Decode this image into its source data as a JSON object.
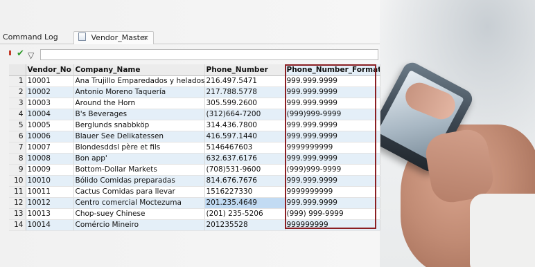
{
  "tabs": {
    "command_log": "Command Log",
    "vendor_master": "Vendor_Master",
    "close_glyph": "×"
  },
  "toolbar": {
    "filter_value": "",
    "icons": [
      "red-marker-icon",
      "check-icon",
      "filter-icon"
    ]
  },
  "grid": {
    "columns": [
      "Vendor_No",
      "Company_Name",
      "Phone_Number",
      "Phone_Number_Format"
    ],
    "rows": [
      {
        "n": "1",
        "vendor_no": "10001",
        "company": "Ana Trujillo Emparedados y helados",
        "phone": "216.497.5471",
        "format": "999.999.9999"
      },
      {
        "n": "2",
        "vendor_no": "10002",
        "company": "Antonio Moreno Taquería",
        "phone": "217.788.5778",
        "format": "999.999.9999"
      },
      {
        "n": "3",
        "vendor_no": "10003",
        "company": "Around the Horn",
        "phone": "305.599.2600",
        "format": "999.999.9999"
      },
      {
        "n": "4",
        "vendor_no": "10004",
        "company": "B's Beverages",
        "phone": "(312)664-7200",
        "format": "(999)999-9999"
      },
      {
        "n": "5",
        "vendor_no": "10005",
        "company": "Berglunds snabbköp",
        "phone": "314.436.7800",
        "format": "999.999.9999"
      },
      {
        "n": "6",
        "vendor_no": "10006",
        "company": "Blauer See Delikatessen",
        "phone": "416.597.1440",
        "format": "999.999.9999"
      },
      {
        "n": "7",
        "vendor_no": "10007",
        "company": "Blondesddsl père et fils",
        "phone": "5146467603",
        "format": "9999999999"
      },
      {
        "n": "8",
        "vendor_no": "10008",
        "company": "Bon app'",
        "phone": "632.637.6176",
        "format": "999.999.9999"
      },
      {
        "n": "9",
        "vendor_no": "10009",
        "company": "Bottom-Dollar Markets",
        "phone": "(708)531-9600",
        "format": "(999)999-9999"
      },
      {
        "n": "10",
        "vendor_no": "10010",
        "company": "Bólido Comidas preparadas",
        "phone": "814.676.7676",
        "format": "999.999.9999"
      },
      {
        "n": "11",
        "vendor_no": "10011",
        "company": "Cactus Comidas para llevar",
        "phone": "1516227330",
        "format": "9999999999"
      },
      {
        "n": "12",
        "vendor_no": "10012",
        "company": "Centro comercial Moctezuma",
        "phone": "201.235.4649",
        "format": "999.999.9999"
      },
      {
        "n": "13",
        "vendor_no": "10013",
        "company": "Chop-suey Chinese",
        "phone": "(201) 235-5206",
        "format": "(999) 999-9999"
      },
      {
        "n": "14",
        "vendor_no": "10014",
        "company": "Comércio Mineiro",
        "phone": "201235528",
        "format": "999999999"
      }
    ],
    "selected_cell": {
      "row": 12,
      "column": "Phone_Number"
    }
  },
  "colors": {
    "highlight_outline": "#8b1f23",
    "stripe": "#e4eff8",
    "selected_cell": "#c2dbf3"
  }
}
